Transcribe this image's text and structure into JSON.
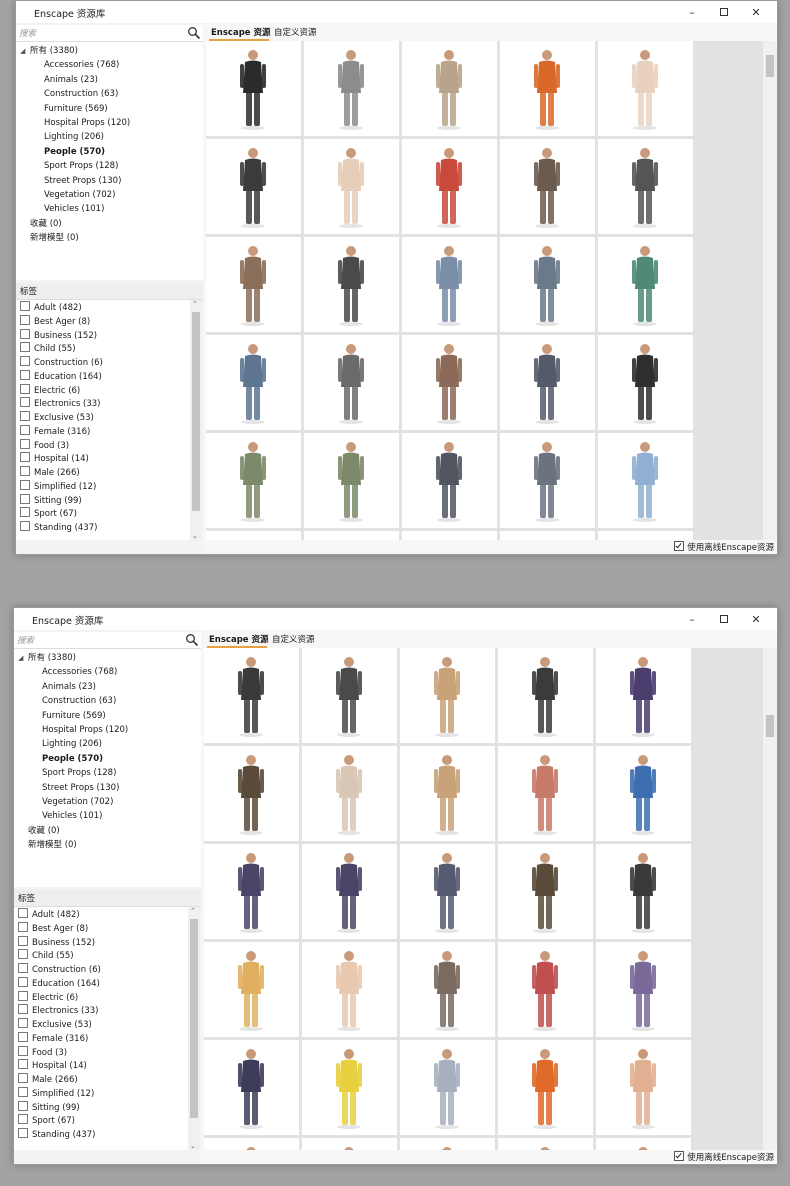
{
  "windows": [
    {
      "title": "Enscape 资源库",
      "search": {
        "placeholder": "搜索"
      },
      "tree": [
        {
          "label": "所有 (3380)",
          "level": 0,
          "expanded": true
        },
        {
          "label": "Accessories (768)",
          "level": 1
        },
        {
          "label": "Animals (23)",
          "level": 1
        },
        {
          "label": "Construction (63)",
          "level": 1
        },
        {
          "label": "Furniture (569)",
          "level": 1
        },
        {
          "label": "Hospital Props (120)",
          "level": 1
        },
        {
          "label": "Lighting (206)",
          "level": 1
        },
        {
          "label": "People (570)",
          "level": 1,
          "selected": true
        },
        {
          "label": "Sport Props (128)",
          "level": 1
        },
        {
          "label": "Street Props (130)",
          "level": 1
        },
        {
          "label": "Vegetation (702)",
          "level": 1
        },
        {
          "label": "Vehicles (101)",
          "level": 1
        },
        {
          "label": "收藏 (0)",
          "level": 0
        },
        {
          "label": "新增模型 (0)",
          "level": 0
        }
      ],
      "tags_header": "标签",
      "tags": [
        "Adult (482)",
        "Best Ager (8)",
        "Business (152)",
        "Child (55)",
        "Construction (6)",
        "Education (164)",
        "Electric (6)",
        "Electronics (33)",
        "Exclusive (53)",
        "Female (316)",
        "Food (3)",
        "Hospital (14)",
        "Male (266)",
        "Simplified (12)",
        "Sitting (99)",
        "Sport (67)",
        "Standing (437)"
      ],
      "tabs": [
        "Enscape 资源",
        "自定义资源"
      ],
      "offline_label": "使用离线Enscape资源",
      "scroll_fraction": 0.03,
      "palette": [
        "#2b2b2b",
        "#8c8c8c",
        "#b8a48a",
        "#d9692a",
        "#e8d2bf",
        "#3b3b3b",
        "#e6cdb8",
        "#c94a3a",
        "#6b5a4e",
        "#555555",
        "#8a6f5a",
        "#4a4a4a",
        "#7a8ea8",
        "#6a7a8a",
        "#4f8a74",
        "#5d7590",
        "#6a6a6a",
        "#8c6a58",
        "#555a6b",
        "#2f2f2f",
        "#7d8a6a",
        "#7d8a6a",
        "#505560",
        "#6b7280",
        "#8fb0d0"
      ]
    },
    {
      "title": "Enscape 资源库",
      "search": {
        "placeholder": "搜索"
      },
      "tree": [
        {
          "label": "所有 (3380)",
          "level": 0,
          "expanded": true
        },
        {
          "label": "Accessories (768)",
          "level": 1
        },
        {
          "label": "Animals (23)",
          "level": 1
        },
        {
          "label": "Construction (63)",
          "level": 1
        },
        {
          "label": "Furniture (569)",
          "level": 1
        },
        {
          "label": "Hospital Props (120)",
          "level": 1
        },
        {
          "label": "Lighting (206)",
          "level": 1
        },
        {
          "label": "People (570)",
          "level": 1,
          "selected": true
        },
        {
          "label": "Sport Props (128)",
          "level": 1
        },
        {
          "label": "Street Props (130)",
          "level": 1
        },
        {
          "label": "Vegetation (702)",
          "level": 1
        },
        {
          "label": "Vehicles (101)",
          "level": 1
        },
        {
          "label": "收藏 (0)",
          "level": 0
        },
        {
          "label": "新增模型 (0)",
          "level": 0
        }
      ],
      "tags_header": "标签",
      "tags": [
        "Adult (482)",
        "Best Ager (8)",
        "Business (152)",
        "Child (55)",
        "Construction (6)",
        "Education (164)",
        "Electric (6)",
        "Electronics (33)",
        "Exclusive (53)",
        "Female (316)",
        "Food (3)",
        "Hospital (14)",
        "Male (266)",
        "Simplified (12)",
        "Sitting (99)",
        "Sport (67)",
        "Standing (437)"
      ],
      "tabs": [
        "Enscape 资源",
        "自定义资源"
      ],
      "offline_label": "使用离线Enscape资源",
      "scroll_fraction": 0.14,
      "palette": [
        "#3a3a3a",
        "#4a4a4a",
        "#c9a27a",
        "#3b3b3b",
        "#4b3d6e",
        "#5a4a3a",
        "#d8c7b5",
        "#c9a27a",
        "#c87a6a",
        "#3d6fb0",
        "#4a4566",
        "#4a4566",
        "#555a70",
        "#5a4a3a",
        "#3a3a3a",
        "#e0b060",
        "#e8c9b0",
        "#7a6a60",
        "#c05050",
        "#7a6a9a",
        "#3d3d5a",
        "#e8d040",
        "#a8b0c0",
        "#e06a2a",
        "#e0b090"
      ]
    }
  ]
}
